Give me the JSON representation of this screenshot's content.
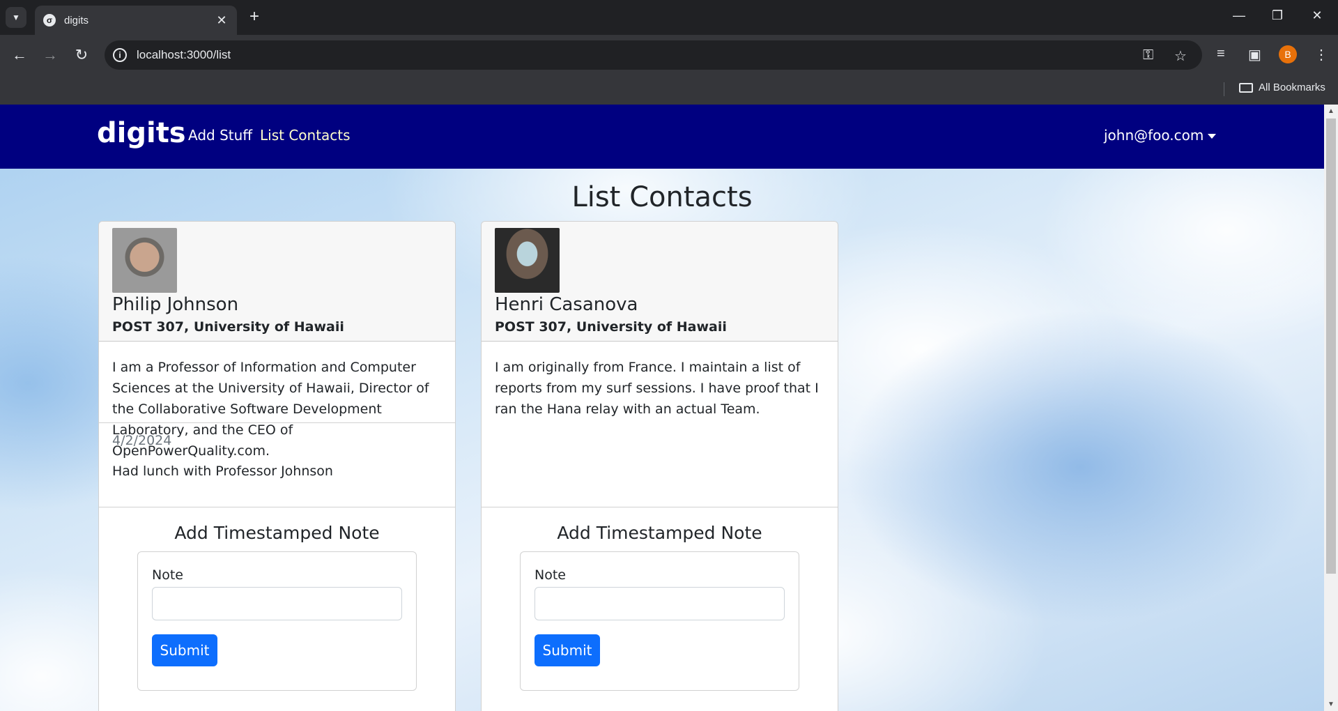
{
  "browser": {
    "tab_title": "digits",
    "url": "localhost:3000/list",
    "bookmarks_label": "All Bookmarks",
    "profile_initial": "B"
  },
  "navbar": {
    "brand": "digits",
    "links": [
      "Add Stuff",
      "List Contacts"
    ],
    "user": "john@foo.com"
  },
  "page": {
    "title": "List Contacts"
  },
  "contacts": [
    {
      "name": "Philip Johnson",
      "address": "POST 307, University of Hawaii",
      "description": "I am a Professor of Information and Computer Sciences at the University of Hawaii, Director of the Collaborative Software Development Laboratory, and the CEO of OpenPowerQuality.com.",
      "note_date": "4/2/2024",
      "note_text": "Had lunch with Professor Johnson"
    },
    {
      "name": "Henri Casanova",
      "address": "POST 307, University of Hawaii",
      "description": "I am originally from France. I maintain a list of reports from my surf sessions. I have proof that I ran the Hana relay with an actual Team."
    }
  ],
  "note_form": {
    "title": "Add Timestamped Note",
    "label": "Note",
    "submit": "Submit"
  }
}
